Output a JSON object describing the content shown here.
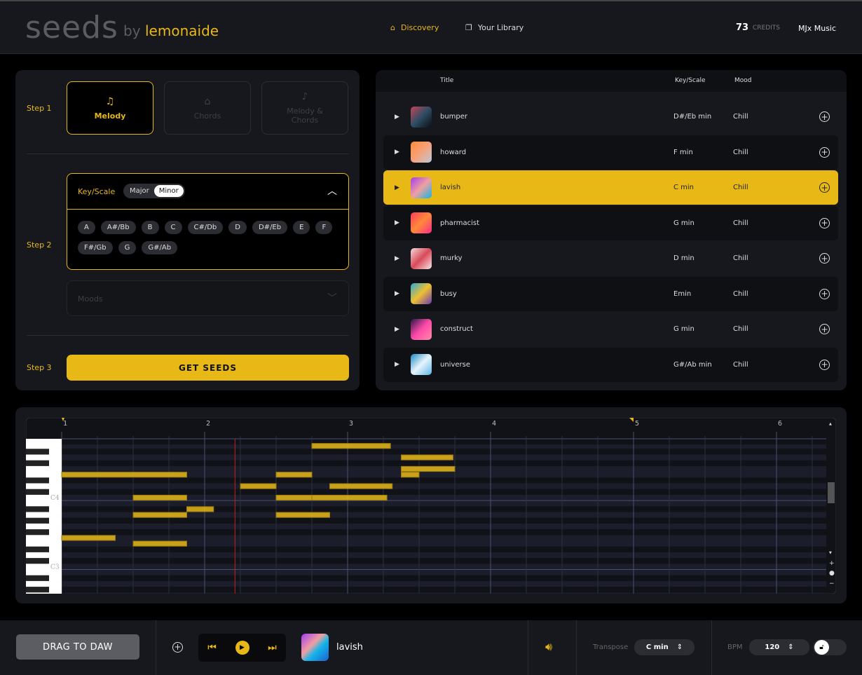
{
  "header": {
    "logo_main": "seeds",
    "logo_by": "by",
    "logo_brand": "lemonaide",
    "nav": [
      {
        "label": "Discovery",
        "icon": "home-icon",
        "active": true
      },
      {
        "label": "Your Library",
        "icon": "library-icon",
        "active": false
      }
    ],
    "credits_value": "73",
    "credits_label": "CREDITS",
    "user": "MJx Music"
  },
  "steps": {
    "step1": "Step 1",
    "step2": "Step 2",
    "step3": "Step 3",
    "modes": [
      {
        "label": "Melody",
        "icon": "music-notes-icon",
        "active": true
      },
      {
        "label": "Chords",
        "icon": "piano-icon",
        "active": false
      },
      {
        "label": "Melody & Chords",
        "icon": "piano-notes-icon",
        "active": false
      }
    ],
    "key_label": "Key/Scale",
    "scale_options": [
      "Major",
      "Minor"
    ],
    "scale_selected": "Minor",
    "keys": [
      "A",
      "A#/Bb",
      "B",
      "C",
      "C#/Db",
      "D",
      "D#/Eb",
      "E",
      "F",
      "F#/Gb",
      "G",
      "G#/Ab"
    ],
    "moods_placeholder": "Moods",
    "get_seeds": "GET SEEDS"
  },
  "tracks": {
    "headers": {
      "title": "Title",
      "key": "Key/Scale",
      "mood": "Mood"
    },
    "rows": [
      {
        "title": "bumper",
        "key": "D#/Eb min",
        "mood": "Chill",
        "colors": [
          "#c4465a",
          "#2e4d63",
          "#0b0f18"
        ]
      },
      {
        "title": "howard",
        "key": "F min",
        "mood": "Chill",
        "colors": [
          "#ff8a3a",
          "#f6a37a",
          "#b9c8d8"
        ]
      },
      {
        "title": "lavish",
        "key": "C min",
        "mood": "Chill",
        "colors": [
          "#a23cf0",
          "#f0a0a0",
          "#12b5e8"
        ],
        "selected": true
      },
      {
        "title": "pharmacist",
        "key": "G min",
        "mood": "Chill",
        "colors": [
          "#ff3a5a",
          "#ff8a3a",
          "#ff2a8a"
        ]
      },
      {
        "title": "murky",
        "key": "D min",
        "mood": "Chill",
        "colors": [
          "#f2dada",
          "#d94a5a",
          "#f6e6e6"
        ]
      },
      {
        "title": "busy",
        "key": "Emin",
        "mood": "Chill",
        "colors": [
          "#2aa8d8",
          "#f0c030",
          "#6a3ab8"
        ]
      },
      {
        "title": "construct",
        "key": "G min",
        "mood": "Chill",
        "colors": [
          "#2a1848",
          "#ff4aa8",
          "#ff8aa8"
        ]
      },
      {
        "title": "universe",
        "key": "G#/Ab min",
        "mood": "Chill",
        "colors": [
          "#1a8ac8",
          "#e8f4fa",
          "#5ab8e8"
        ]
      }
    ]
  },
  "piano_roll": {
    "bars": [
      "1",
      "2",
      "3",
      "4",
      "5",
      "6"
    ],
    "octave_labels": [
      "C4",
      "C3"
    ],
    "notes": [
      {
        "pitch": 64,
        "start": 0,
        "dur": 3.5
      },
      {
        "pitch": 53,
        "start": 0,
        "dur": 1.5
      },
      {
        "pitch": 60,
        "start": 2,
        "dur": 1.5
      },
      {
        "pitch": 57,
        "start": 2,
        "dur": 1.5
      },
      {
        "pitch": 52,
        "start": 2,
        "dur": 1.5
      },
      {
        "pitch": 58,
        "start": 3.5,
        "dur": 0.75
      },
      {
        "pitch": 62,
        "start": 5,
        "dur": 1
      },
      {
        "pitch": 64,
        "start": 6,
        "dur": 1
      },
      {
        "pitch": 60,
        "start": 6,
        "dur": 1
      },
      {
        "pitch": 60,
        "start": 7,
        "dur": 2.1
      },
      {
        "pitch": 57,
        "start": 6,
        "dur": 1.5
      },
      {
        "pitch": 69,
        "start": 7,
        "dur": 2.2
      },
      {
        "pitch": 62,
        "start": 7.5,
        "dur": 1.75
      },
      {
        "pitch": 67,
        "start": 9.5,
        "dur": 1.45
      },
      {
        "pitch": 65,
        "start": 9.5,
        "dur": 1.5
      },
      {
        "pitch": 64,
        "start": 9.5,
        "dur": 0.5
      }
    ],
    "playhead_beat": 4.85,
    "accent": "#e8b817"
  },
  "footer": {
    "drag": "DRAG TO DAW",
    "now_playing": "lavish",
    "transpose_label": "Transpose",
    "transpose_value": "C min",
    "bpm_label": "BPM",
    "bpm_value": "120"
  }
}
